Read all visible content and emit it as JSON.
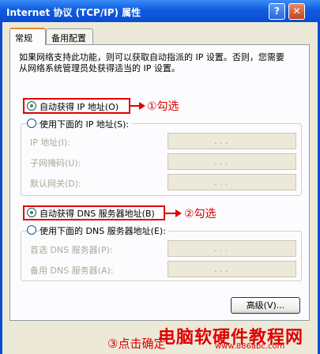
{
  "window": {
    "title": "Internet 协议 (TCP/IP) 属性",
    "help_button": "?",
    "close_button": "✕"
  },
  "tabs": [
    {
      "label": "常规",
      "active": true
    },
    {
      "label": "备用配置",
      "active": false
    }
  ],
  "description": "如果网络支持此功能，则可以获取自动指派的 IP 设置。否则，您需要从网络系统管理员处获得适当的 IP 设置。",
  "ip_options": {
    "auto": {
      "label": "自动获得 IP 地址(O)",
      "checked": true
    },
    "manual": {
      "label": "使用下面的 IP 地址(S):",
      "checked": false
    }
  },
  "ip_fields": [
    {
      "label": "IP 地址(I):",
      "value": ". . ."
    },
    {
      "label": "子网掩码(U):",
      "value": ". . ."
    },
    {
      "label": "默认网关(D):",
      "value": ". . ."
    }
  ],
  "dns_options": {
    "auto": {
      "label": "自动获得 DNS 服务器地址(B)",
      "checked": true
    },
    "manual": {
      "label": "使用下面的 DNS 服务器地址(E):",
      "checked": false
    }
  },
  "dns_fields": [
    {
      "label": "首选 DNS 服务器(P):",
      "value": ". . ."
    },
    {
      "label": "备用 DNS 服务器(A):",
      "value": ". . ."
    }
  ],
  "advanced_button": "高级(V)...",
  "annotations": {
    "step1": "①勾选",
    "step2": "②勾选",
    "step3": "③点击确定"
  },
  "watermark": {
    "text": "电脑软硬件教程网",
    "url": "www.886abc.com"
  },
  "colors": {
    "annotation": "#e00000",
    "titlebar": "#0a4cd0",
    "dialog_bg": "#ece9d8"
  }
}
